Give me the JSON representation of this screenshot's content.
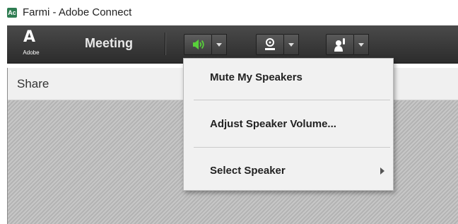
{
  "window": {
    "title": "Farmi - Adobe Connect",
    "app_icon": "adobe-connect-icon"
  },
  "toolbar": {
    "logo_word": "Adobe",
    "meeting_label": "Meeting",
    "speaker_color": "#58d03a",
    "buttons": [
      "speaker-icon",
      "camera-icon",
      "raise-hand-icon"
    ]
  },
  "share": {
    "title": "Share"
  },
  "speaker_menu": {
    "items": [
      {
        "label": "Mute My Speakers"
      },
      {
        "label": "Adjust Speaker Volume..."
      },
      {
        "label": "Select Speaker",
        "has_submenu": true
      }
    ]
  }
}
